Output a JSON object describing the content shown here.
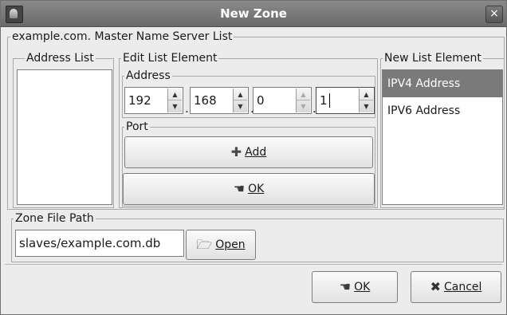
{
  "window": {
    "title": "New Zone",
    "close_glyph": "×"
  },
  "icons": {
    "window_icon": "app-icon",
    "add": "plus-icon",
    "ok": "hand-ok-icon",
    "open": "folder-open-icon",
    "cancel": "x-icon"
  },
  "master_list": {
    "legend": "example.com. Master Name Server List",
    "address_list_legend": "Address List",
    "edit_legend": "Edit List Element",
    "address_legend": "Address",
    "address_octets": [
      "192",
      "168",
      "0",
      "1"
    ],
    "octet_separator": ".",
    "port_legend": "Port",
    "add_label": "Add",
    "ok_label": "OK",
    "new_element_legend": "New List Element",
    "new_element_options": [
      "IPV4 Address",
      "IPV6 Address"
    ],
    "selected_option": "IPV4 Address"
  },
  "zone_file": {
    "legend": "Zone File Path",
    "value": "slaves/example.com.db",
    "open_label": "Open"
  },
  "footer": {
    "ok_label": "OK",
    "cancel_label": "Cancel"
  }
}
